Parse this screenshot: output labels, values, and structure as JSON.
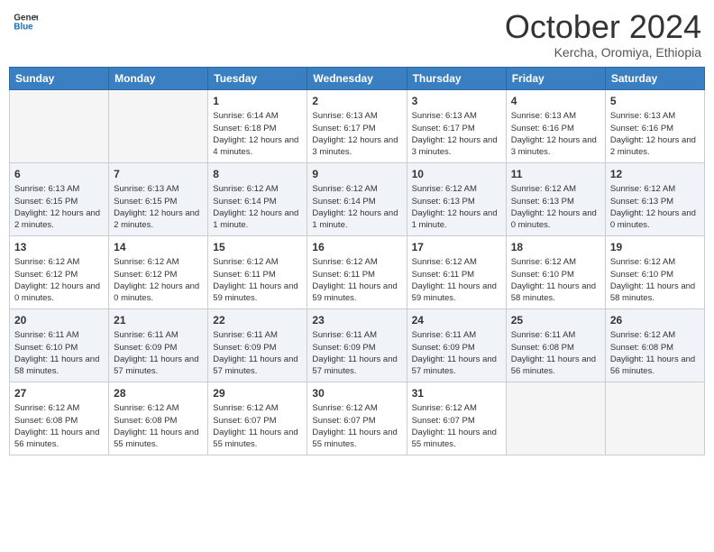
{
  "logo": {
    "line1": "General",
    "line2": "Blue"
  },
  "title": "October 2024",
  "subtitle": "Kercha, Oromiya, Ethiopia",
  "weekdays": [
    "Sunday",
    "Monday",
    "Tuesday",
    "Wednesday",
    "Thursday",
    "Friday",
    "Saturday"
  ],
  "weeks": [
    [
      {
        "day": "",
        "info": ""
      },
      {
        "day": "",
        "info": ""
      },
      {
        "day": "1",
        "sunrise": "6:14 AM",
        "sunset": "6:18 PM",
        "daylight": "12 hours and 4 minutes."
      },
      {
        "day": "2",
        "sunrise": "6:13 AM",
        "sunset": "6:17 PM",
        "daylight": "12 hours and 3 minutes."
      },
      {
        "day": "3",
        "sunrise": "6:13 AM",
        "sunset": "6:17 PM",
        "daylight": "12 hours and 3 minutes."
      },
      {
        "day": "4",
        "sunrise": "6:13 AM",
        "sunset": "6:16 PM",
        "daylight": "12 hours and 3 minutes."
      },
      {
        "day": "5",
        "sunrise": "6:13 AM",
        "sunset": "6:16 PM",
        "daylight": "12 hours and 2 minutes."
      }
    ],
    [
      {
        "day": "6",
        "sunrise": "6:13 AM",
        "sunset": "6:15 PM",
        "daylight": "12 hours and 2 minutes."
      },
      {
        "day": "7",
        "sunrise": "6:13 AM",
        "sunset": "6:15 PM",
        "daylight": "12 hours and 2 minutes."
      },
      {
        "day": "8",
        "sunrise": "6:12 AM",
        "sunset": "6:14 PM",
        "daylight": "12 hours and 1 minute."
      },
      {
        "day": "9",
        "sunrise": "6:12 AM",
        "sunset": "6:14 PM",
        "daylight": "12 hours and 1 minute."
      },
      {
        "day": "10",
        "sunrise": "6:12 AM",
        "sunset": "6:13 PM",
        "daylight": "12 hours and 1 minute."
      },
      {
        "day": "11",
        "sunrise": "6:12 AM",
        "sunset": "6:13 PM",
        "daylight": "12 hours and 0 minutes."
      },
      {
        "day": "12",
        "sunrise": "6:12 AM",
        "sunset": "6:13 PM",
        "daylight": "12 hours and 0 minutes."
      }
    ],
    [
      {
        "day": "13",
        "sunrise": "6:12 AM",
        "sunset": "6:12 PM",
        "daylight": "12 hours and 0 minutes."
      },
      {
        "day": "14",
        "sunrise": "6:12 AM",
        "sunset": "6:12 PM",
        "daylight": "12 hours and 0 minutes."
      },
      {
        "day": "15",
        "sunrise": "6:12 AM",
        "sunset": "6:11 PM",
        "daylight": "11 hours and 59 minutes."
      },
      {
        "day": "16",
        "sunrise": "6:12 AM",
        "sunset": "6:11 PM",
        "daylight": "11 hours and 59 minutes."
      },
      {
        "day": "17",
        "sunrise": "6:12 AM",
        "sunset": "6:11 PM",
        "daylight": "11 hours and 59 minutes."
      },
      {
        "day": "18",
        "sunrise": "6:12 AM",
        "sunset": "6:10 PM",
        "daylight": "11 hours and 58 minutes."
      },
      {
        "day": "19",
        "sunrise": "6:12 AM",
        "sunset": "6:10 PM",
        "daylight": "11 hours and 58 minutes."
      }
    ],
    [
      {
        "day": "20",
        "sunrise": "6:11 AM",
        "sunset": "6:10 PM",
        "daylight": "11 hours and 58 minutes."
      },
      {
        "day": "21",
        "sunrise": "6:11 AM",
        "sunset": "6:09 PM",
        "daylight": "11 hours and 57 minutes."
      },
      {
        "day": "22",
        "sunrise": "6:11 AM",
        "sunset": "6:09 PM",
        "daylight": "11 hours and 57 minutes."
      },
      {
        "day": "23",
        "sunrise": "6:11 AM",
        "sunset": "6:09 PM",
        "daylight": "11 hours and 57 minutes."
      },
      {
        "day": "24",
        "sunrise": "6:11 AM",
        "sunset": "6:09 PM",
        "daylight": "11 hours and 57 minutes."
      },
      {
        "day": "25",
        "sunrise": "6:11 AM",
        "sunset": "6:08 PM",
        "daylight": "11 hours and 56 minutes."
      },
      {
        "day": "26",
        "sunrise": "6:12 AM",
        "sunset": "6:08 PM",
        "daylight": "11 hours and 56 minutes."
      }
    ],
    [
      {
        "day": "27",
        "sunrise": "6:12 AM",
        "sunset": "6:08 PM",
        "daylight": "11 hours and 56 minutes."
      },
      {
        "day": "28",
        "sunrise": "6:12 AM",
        "sunset": "6:08 PM",
        "daylight": "11 hours and 55 minutes."
      },
      {
        "day": "29",
        "sunrise": "6:12 AM",
        "sunset": "6:07 PM",
        "daylight": "11 hours and 55 minutes."
      },
      {
        "day": "30",
        "sunrise": "6:12 AM",
        "sunset": "6:07 PM",
        "daylight": "11 hours and 55 minutes."
      },
      {
        "day": "31",
        "sunrise": "6:12 AM",
        "sunset": "6:07 PM",
        "daylight": "11 hours and 55 minutes."
      },
      {
        "day": "",
        "info": ""
      },
      {
        "day": "",
        "info": ""
      }
    ]
  ]
}
